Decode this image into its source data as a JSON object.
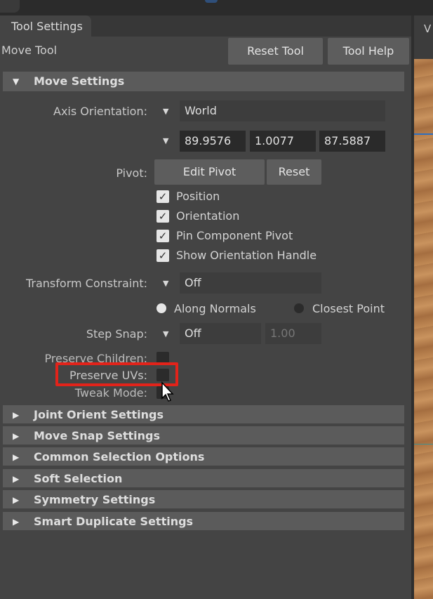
{
  "window": {
    "tab_label": "Tool Settings",
    "tool_name": "Move Tool",
    "viewport_label": "V"
  },
  "toolbar": {
    "reset_tool": "Reset Tool",
    "tool_help": "Tool Help"
  },
  "move_settings": {
    "header": "Move Settings",
    "axis_orientation_label": "Axis Orientation:",
    "axis_orientation_value": "World",
    "custom_values": [
      "89.9576",
      "1.0077",
      "87.5887"
    ],
    "pivot_label": "Pivot:",
    "edit_pivot": "Edit Pivot",
    "reset": "Reset",
    "checkboxes": [
      {
        "label": "Position",
        "checked": true
      },
      {
        "label": "Orientation",
        "checked": true
      },
      {
        "label": "Pin Component Pivot",
        "checked": true
      },
      {
        "label": "Show Orientation Handle",
        "checked": true
      }
    ],
    "transform_constraint_label": "Transform Constraint:",
    "transform_constraint_value": "Off",
    "along_normals": "Along Normals",
    "closest_point": "Closest Point",
    "step_snap_label": "Step Snap:",
    "step_snap_value": "Off",
    "step_snap_amount": "1.00",
    "preserve_children_label": "Preserve Children:",
    "preserve_uvs_label": "Preserve UVs:",
    "tweak_mode_label": "Tweak Mode:"
  },
  "sections": [
    "Joint Orient Settings",
    "Move Snap Settings",
    "Common Selection Options",
    "Soft Selection",
    "Symmetry Settings",
    "Smart Duplicate Settings"
  ],
  "colors": {
    "panel": "#444444",
    "header": "#5b5b5b",
    "highlight": "#e2231a"
  },
  "icons": [
    "expand-arrow-icon",
    "collapse-arrow-icon",
    "dropdown-arrow-icon",
    "checkmark-icon",
    "mouse-cursor-icon"
  ]
}
